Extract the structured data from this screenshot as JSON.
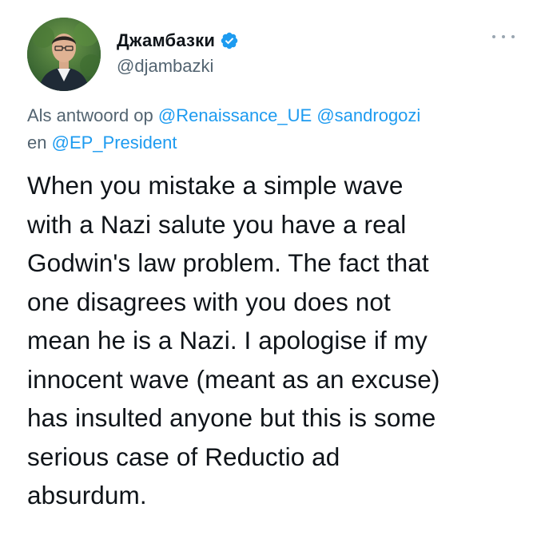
{
  "author": {
    "display_name": "Джамбазки",
    "handle": "@djambazki",
    "verified_icon": "verified-badge-icon",
    "avatar_icon": "profile-photo"
  },
  "more_icon": "more-options-icon",
  "reply_context": {
    "prefix": "Als antwoord op",
    "mention_1": "@Renaissance_UE",
    "mention_2": "@sandrogozi",
    "joiner": "en",
    "mention_3": "@EP_President"
  },
  "tweet": {
    "lines": [
      "When you mistake a simple wave",
      "with a Nazi salute you have a real",
      "Godwin's law problem. The fact that",
      "one disagrees with you does not",
      "mean he is a Nazi. I apologise if my",
      "innocent wave (meant as an excuse)",
      "has insulted anyone but this is some",
      "serious case of Reductio ad",
      "absurdum."
    ]
  },
  "colors": {
    "text": "#0f1419",
    "secondary": "#536471",
    "link": "#1d9bf0",
    "verified": "#1d9bf0"
  }
}
